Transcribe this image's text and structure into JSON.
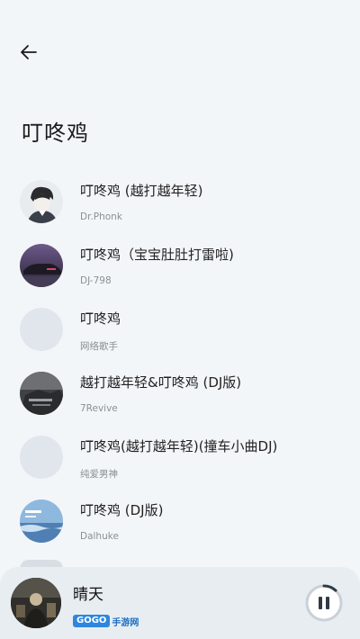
{
  "header": {
    "back_icon": "arrow-left-icon",
    "title": "叮咚鸡"
  },
  "songs": [
    {
      "title": "叮咚鸡 (越打越年轻)",
      "artist": "Dr.Phonk",
      "cover": "anime-boy"
    },
    {
      "title": "叮咚鸡（宝宝肚肚打雷啦)",
      "artist": "DJ-798",
      "cover": "purple-car"
    },
    {
      "title": "叮咚鸡",
      "artist": "网络歌手",
      "cover": "blank"
    },
    {
      "title": "越打越年轻&叮咚鸡 (DJ版)",
      "artist": "7Revive",
      "cover": "dark-photo"
    },
    {
      "title": "叮咚鸡(越打越年轻)(撞车小曲DJ)",
      "artist": "纯爱男神",
      "cover": "blank"
    },
    {
      "title": "叮咚鸡 (DJ版)",
      "artist": "Dalhuke",
      "cover": "no-hope"
    }
  ],
  "player": {
    "title": "晴天",
    "watermark_badge": "GOGO",
    "watermark_text": "手游网",
    "play_icon": "pause-icon",
    "progress": 0.12
  },
  "colors": {
    "background": "#f3f6f9",
    "player_bg": "#e8edf2",
    "accent": "#2f3a45"
  }
}
